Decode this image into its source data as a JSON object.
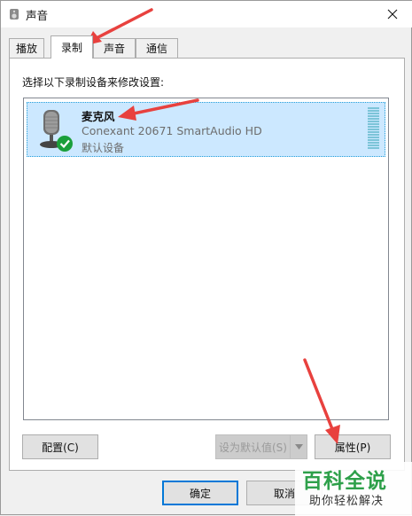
{
  "window": {
    "title": "声音",
    "close_glyph": "✕"
  },
  "tabs": [
    {
      "label": "播放",
      "active": false
    },
    {
      "label": "录制",
      "active": true
    },
    {
      "label": "声音",
      "active": false
    },
    {
      "label": "通信",
      "active": false
    }
  ],
  "instruction": "选择以下录制设备来修改设置:",
  "devices": [
    {
      "name": "麦克风",
      "description": "Conexant 20671 SmartAudio HD",
      "status": "默认设备",
      "icon": "microphone-icon",
      "status_icon": "default-check-icon",
      "selected": true
    }
  ],
  "buttons": {
    "configure": "配置(C)",
    "set_default": "设为默认值(S)",
    "properties": "属性(P)",
    "ok": "确定",
    "cancel": "取消"
  },
  "watermark": {
    "main": "百科全说",
    "sub": "助你轻松解决"
  },
  "colors": {
    "selection": "#cce8ff",
    "accent": "#0078d7",
    "arrow": "#e8413e",
    "check": "#1a9f3a",
    "watermark": "#2ea04a"
  }
}
